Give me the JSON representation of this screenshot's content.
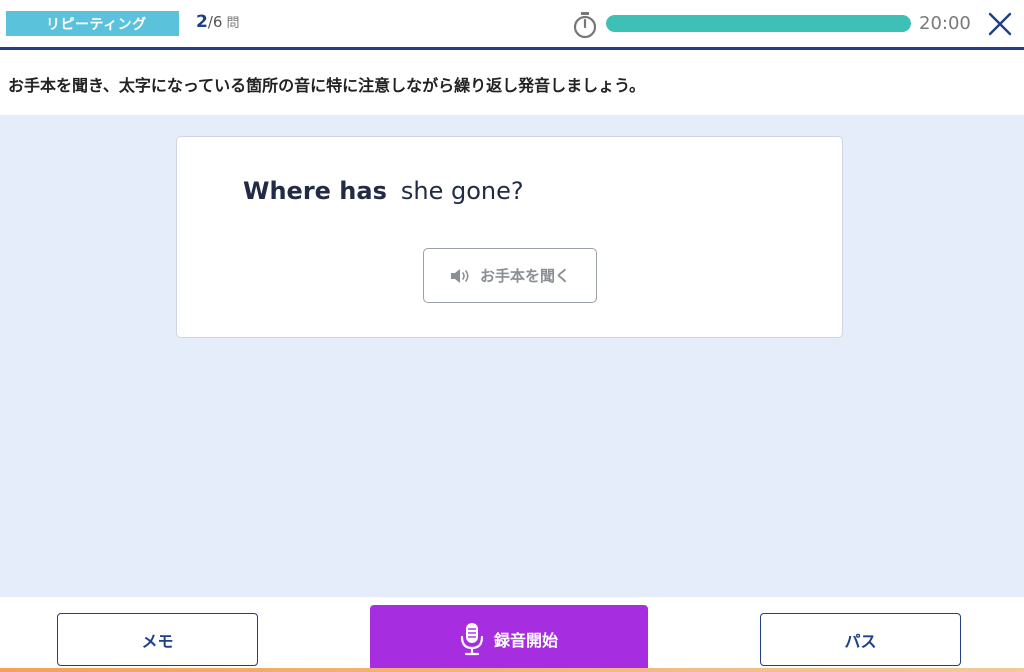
{
  "header": {
    "category": "リピーティング",
    "progress": {
      "current": "2",
      "separator": "/",
      "total": "6",
      "unit": "問"
    },
    "timer": {
      "remaining": "20:00",
      "fraction_remaining": 1.0,
      "bar_color": "#3ec0b6"
    },
    "close_icon": "close-icon"
  },
  "instruction": "お手本を聞き、太字になっている箇所の音に特に注意しながら繰り返し発音しましょう。",
  "card": {
    "sentence_bold": "Where has",
    "sentence_rest": "she gone?",
    "listen_label": "お手本を聞く",
    "listen_icon": "speaker-icon"
  },
  "footer": {
    "memo_label": "メモ",
    "record_label": "録音開始",
    "record_icon": "microphone-icon",
    "pass_label": "パス",
    "record_color": "#a72ee0",
    "accent_color": "#1f3f8a"
  }
}
